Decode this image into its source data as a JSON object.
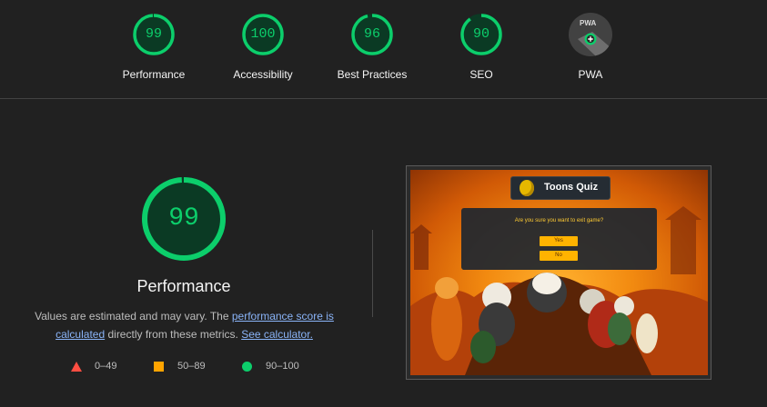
{
  "header": {
    "categories": [
      {
        "score": "99",
        "label": "Performance"
      },
      {
        "score": "100",
        "label": "Accessibility"
      },
      {
        "score": "96",
        "label": "Best Practices"
      },
      {
        "score": "90",
        "label": "SEO"
      }
    ],
    "pwa": {
      "label": "PWA",
      "badge_text": "PWA",
      "icon": "pwa-badge-icon"
    }
  },
  "performance": {
    "score": "99",
    "title": "Performance",
    "desc_prefix": "Values are estimated and may vary. The ",
    "link_score": "performance score is calculated",
    "desc_middle": " directly from these metrics. ",
    "link_calc": "See calculator."
  },
  "legend": [
    {
      "range": "0–49",
      "icon": "red-triangle-icon",
      "color": "#ff4e42"
    },
    {
      "range": "50–89",
      "icon": "orange-square-icon",
      "color": "#ffa400"
    },
    {
      "range": "90–100",
      "icon": "green-circle-icon",
      "color": "#0cce6b"
    }
  ],
  "screenshot": {
    "app_title": "Toons Quiz",
    "dialog_question": "Are you sure you want to exit game?",
    "yes_label": "Yes",
    "no_label": "No"
  },
  "colors": {
    "pass": "#0cce6b",
    "pass_bg": "#0b3a24",
    "background": "#212121",
    "link": "#8ab4f8"
  }
}
